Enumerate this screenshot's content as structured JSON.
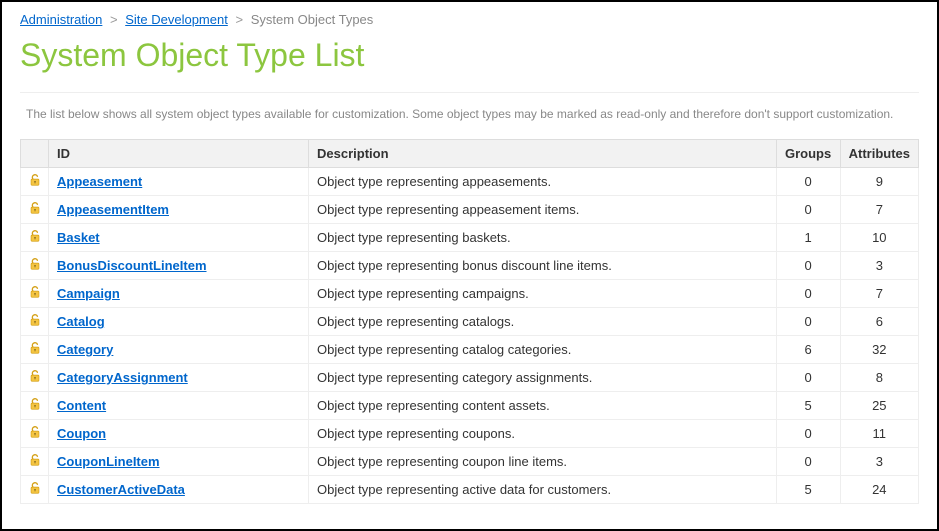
{
  "breadcrumb": {
    "admin": "Administration",
    "sitedev": "Site Development",
    "current": "System Object Types"
  },
  "page_title": "System Object Type List",
  "intro": "The list below shows all system object types available for customization. Some object types may be marked as read-only and therefore don't support customization.",
  "columns": {
    "id": "ID",
    "description": "Description",
    "groups": "Groups",
    "attributes": "Attributes"
  },
  "rows": [
    {
      "id": "Appeasement",
      "desc": "Object type representing appeasements.",
      "groups": "0",
      "attrs": "9"
    },
    {
      "id": "AppeasementItem",
      "desc": "Object type representing appeasement items.",
      "groups": "0",
      "attrs": "7"
    },
    {
      "id": "Basket",
      "desc": "Object type representing baskets.",
      "groups": "1",
      "attrs": "10"
    },
    {
      "id": "BonusDiscountLineItem",
      "desc": "Object type representing bonus discount line items.",
      "groups": "0",
      "attrs": "3"
    },
    {
      "id": "Campaign",
      "desc": "Object type representing campaigns.",
      "groups": "0",
      "attrs": "7"
    },
    {
      "id": "Catalog",
      "desc": "Object type representing catalogs.",
      "groups": "0",
      "attrs": "6"
    },
    {
      "id": "Category",
      "desc": "Object type representing catalog categories.",
      "groups": "6",
      "attrs": "32"
    },
    {
      "id": "CategoryAssignment",
      "desc": "Object type representing category assignments.",
      "groups": "0",
      "attrs": "8"
    },
    {
      "id": "Content",
      "desc": "Object type representing content assets.",
      "groups": "5",
      "attrs": "25"
    },
    {
      "id": "Coupon",
      "desc": "Object type representing coupons.",
      "groups": "0",
      "attrs": "11"
    },
    {
      "id": "CouponLineItem",
      "desc": "Object type representing coupon line items.",
      "groups": "0",
      "attrs": "3"
    },
    {
      "id": "CustomerActiveData",
      "desc": "Object type representing active data for customers.",
      "groups": "5",
      "attrs": "24"
    }
  ]
}
